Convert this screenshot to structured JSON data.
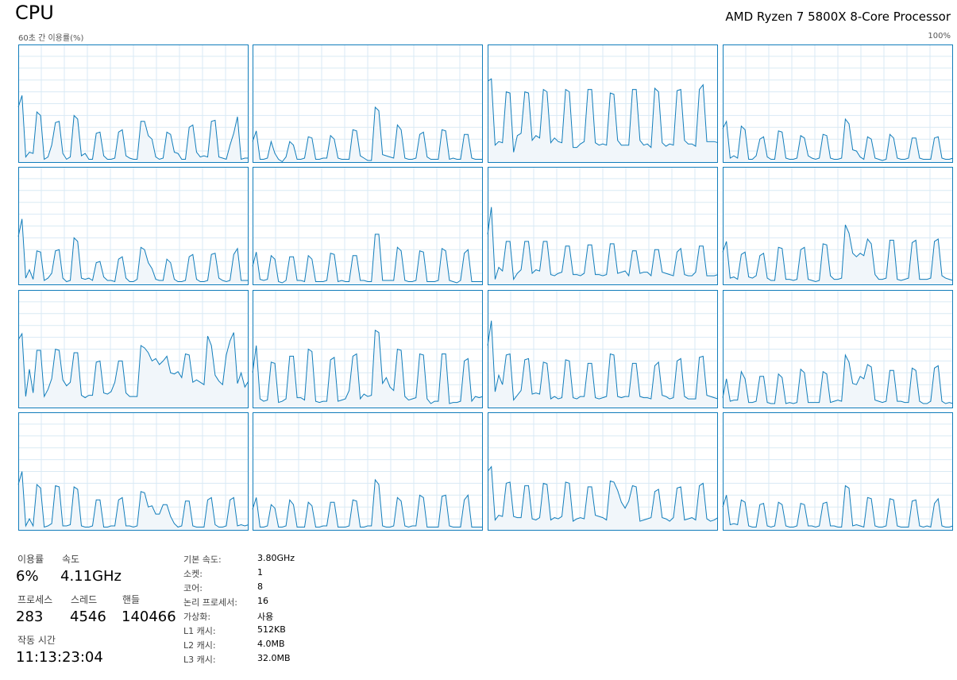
{
  "header": {
    "title": "CPU",
    "processor_name": "AMD Ryzen 7 5800X 8-Core Processor",
    "graph_caption": "60초 간 이용률(%)",
    "graph_max_label": "100%"
  },
  "colors": {
    "graph_border": "#117dbb",
    "graph_line": "#117dbb",
    "graph_fill": "#f1f6fa",
    "grid_line": "#d9eaf4"
  },
  "logical_processor_utilization": {
    "count": 16,
    "range": [
      0,
      100
    ],
    "series": [
      [
        47,
        57,
        5,
        9,
        8,
        43,
        40,
        3,
        5,
        15,
        34,
        35,
        8,
        3,
        5,
        40,
        37,
        6,
        8,
        3,
        3,
        25,
        26,
        6,
        3,
        3,
        4,
        26,
        28,
        6,
        4,
        3,
        3,
        35,
        35,
        23,
        20,
        5,
        3,
        4,
        26,
        24,
        9,
        8,
        3,
        3,
        30,
        32,
        9,
        5,
        6,
        5,
        35,
        36,
        5,
        4,
        3,
        15,
        25,
        39,
        3,
        4,
        4
      ],
      [
        18,
        27,
        3,
        3,
        4,
        18,
        8,
        3,
        1,
        5,
        18,
        15,
        3,
        3,
        4,
        22,
        21,
        3,
        3,
        4,
        4,
        23,
        20,
        4,
        3,
        3,
        3,
        28,
        27,
        6,
        4,
        2,
        2,
        47,
        44,
        7,
        6,
        5,
        4,
        32,
        28,
        4,
        3,
        3,
        4,
        24,
        26,
        5,
        3,
        3,
        3,
        28,
        27,
        3,
        4,
        3,
        3,
        24,
        24,
        4,
        3,
        3,
        3
      ],
      [
        69,
        71,
        15,
        18,
        17,
        60,
        59,
        9,
        23,
        25,
        60,
        59,
        19,
        23,
        21,
        62,
        60,
        17,
        21,
        18,
        17,
        62,
        60,
        13,
        13,
        16,
        18,
        62,
        62,
        17,
        15,
        16,
        15,
        59,
        58,
        19,
        15,
        15,
        15,
        62,
        62,
        19,
        15,
        16,
        13,
        63,
        60,
        17,
        14,
        16,
        15,
        61,
        62,
        19,
        16,
        16,
        14,
        62,
        66,
        18,
        18,
        18,
        17
      ],
      [
        29,
        35,
        4,
        6,
        4,
        31,
        28,
        3,
        3,
        6,
        20,
        22,
        5,
        3,
        3,
        27,
        26,
        4,
        3,
        3,
        4,
        23,
        21,
        6,
        4,
        3,
        4,
        24,
        23,
        4,
        3,
        3,
        4,
        37,
        33,
        11,
        10,
        5,
        3,
        22,
        20,
        4,
        3,
        2,
        3,
        24,
        21,
        4,
        3,
        3,
        4,
        21,
        21,
        4,
        3,
        3,
        3,
        21,
        22,
        4,
        3,
        3,
        4
      ],
      [
        41,
        56,
        6,
        13,
        5,
        29,
        28,
        4,
        6,
        10,
        29,
        30,
        6,
        3,
        4,
        40,
        37,
        6,
        5,
        6,
        4,
        19,
        20,
        7,
        4,
        4,
        3,
        22,
        24,
        6,
        3,
        3,
        5,
        32,
        30,
        19,
        14,
        5,
        4,
        4,
        22,
        19,
        5,
        3,
        3,
        4,
        24,
        26,
        5,
        3,
        3,
        4,
        26,
        27,
        6,
        4,
        3,
        4,
        26,
        31,
        4,
        4,
        4
      ],
      [
        16,
        28,
        5,
        4,
        5,
        25,
        22,
        3,
        2,
        4,
        24,
        24,
        4,
        4,
        3,
        25,
        22,
        3,
        3,
        3,
        4,
        27,
        26,
        3,
        4,
        3,
        3,
        25,
        25,
        4,
        4,
        3,
        3,
        43,
        43,
        4,
        4,
        4,
        4,
        32,
        29,
        4,
        3,
        3,
        4,
        29,
        28,
        3,
        3,
        3,
        4,
        31,
        29,
        4,
        3,
        2,
        4,
        27,
        30,
        3,
        3,
        3,
        3
      ],
      [
        43,
        66,
        5,
        15,
        12,
        37,
        37,
        5,
        10,
        13,
        37,
        37,
        10,
        13,
        12,
        37,
        37,
        9,
        8,
        10,
        11,
        33,
        33,
        9,
        9,
        8,
        10,
        34,
        34,
        9,
        9,
        8,
        9,
        35,
        35,
        10,
        11,
        12,
        8,
        29,
        29,
        10,
        11,
        11,
        8,
        30,
        30,
        11,
        10,
        9,
        8,
        28,
        31,
        9,
        8,
        8,
        11,
        33,
        33,
        8,
        8,
        8,
        9
      ],
      [
        28,
        37,
        6,
        7,
        5,
        26,
        28,
        7,
        6,
        8,
        25,
        27,
        6,
        4,
        4,
        32,
        31,
        5,
        5,
        4,
        5,
        30,
        32,
        5,
        4,
        3,
        4,
        35,
        34,
        8,
        5,
        5,
        6,
        51,
        44,
        27,
        24,
        27,
        25,
        39,
        35,
        9,
        5,
        5,
        6,
        38,
        38,
        5,
        4,
        5,
        6,
        36,
        38,
        5,
        5,
        5,
        6,
        37,
        39,
        8,
        6,
        5,
        4
      ],
      [
        58,
        63,
        10,
        33,
        13,
        49,
        49,
        10,
        16,
        25,
        50,
        49,
        24,
        19,
        22,
        47,
        47,
        11,
        9,
        11,
        11,
        39,
        40,
        13,
        12,
        14,
        22,
        40,
        40,
        13,
        10,
        10,
        10,
        53,
        51,
        47,
        40,
        42,
        37,
        40,
        44,
        30,
        29,
        31,
        26,
        46,
        45,
        22,
        24,
        22,
        20,
        61,
        53,
        28,
        23,
        20,
        45,
        57,
        64,
        21,
        30,
        18,
        23
      ],
      [
        30,
        53,
        8,
        6,
        7,
        39,
        38,
        5,
        6,
        8,
        44,
        44,
        9,
        9,
        7,
        50,
        48,
        6,
        5,
        6,
        6,
        41,
        43,
        6,
        7,
        8,
        15,
        44,
        46,
        8,
        12,
        10,
        11,
        66,
        64,
        21,
        26,
        18,
        15,
        50,
        49,
        10,
        7,
        8,
        9,
        46,
        45,
        8,
        4,
        6,
        6,
        46,
        46,
        4,
        5,
        5,
        6,
        40,
        42,
        6,
        10,
        9,
        10
      ],
      [
        53,
        74,
        14,
        28,
        20,
        45,
        46,
        7,
        11,
        15,
        41,
        42,
        12,
        13,
        12,
        39,
        38,
        8,
        10,
        8,
        9,
        41,
        40,
        9,
        8,
        10,
        10,
        38,
        38,
        9,
        8,
        9,
        10,
        46,
        45,
        10,
        9,
        10,
        10,
        38,
        38,
        10,
        9,
        9,
        8,
        36,
        39,
        11,
        10,
        8,
        9,
        40,
        42,
        10,
        8,
        8,
        8,
        43,
        44,
        11,
        10,
        9,
        8
      ],
      [
        9,
        25,
        6,
        7,
        7,
        31,
        25,
        5,
        5,
        6,
        27,
        27,
        5,
        4,
        4,
        29,
        26,
        4,
        5,
        4,
        5,
        33,
        30,
        5,
        5,
        5,
        5,
        31,
        29,
        5,
        6,
        7,
        6,
        45,
        39,
        21,
        20,
        27,
        25,
        37,
        35,
        7,
        6,
        5,
        6,
        32,
        32,
        6,
        6,
        5,
        5,
        34,
        32,
        6,
        4,
        4,
        6,
        34,
        36,
        6,
        4,
        5,
        4
      ],
      [
        39,
        50,
        4,
        10,
        4,
        39,
        36,
        3,
        4,
        6,
        38,
        37,
        4,
        4,
        5,
        37,
        35,
        4,
        3,
        3,
        4,
        26,
        26,
        3,
        3,
        4,
        4,
        26,
        28,
        4,
        4,
        3,
        4,
        33,
        32,
        20,
        21,
        14,
        14,
        22,
        22,
        12,
        6,
        3,
        4,
        25,
        25,
        4,
        3,
        3,
        3,
        26,
        28,
        5,
        3,
        3,
        4,
        26,
        28,
        4,
        5,
        4,
        5
      ],
      [
        18,
        28,
        3,
        3,
        4,
        22,
        19,
        3,
        3,
        4,
        26,
        22,
        3,
        3,
        3,
        24,
        21,
        3,
        3,
        4,
        4,
        24,
        24,
        3,
        3,
        3,
        4,
        26,
        25,
        3,
        3,
        4,
        4,
        43,
        39,
        4,
        3,
        3,
        4,
        28,
        25,
        4,
        3,
        4,
        4,
        30,
        28,
        3,
        3,
        3,
        3,
        29,
        30,
        4,
        3,
        3,
        3,
        26,
        30,
        3,
        3,
        3,
        3
      ],
      [
        50,
        54,
        9,
        13,
        12,
        40,
        41,
        12,
        11,
        11,
        38,
        38,
        10,
        9,
        11,
        40,
        39,
        9,
        11,
        10,
        12,
        41,
        40,
        8,
        10,
        11,
        10,
        37,
        37,
        13,
        12,
        11,
        9,
        42,
        41,
        34,
        24,
        19,
        25,
        38,
        37,
        8,
        9,
        10,
        11,
        33,
        35,
        11,
        10,
        8,
        11,
        36,
        37,
        9,
        10,
        11,
        9,
        38,
        40,
        10,
        8,
        9,
        11
      ],
      [
        20,
        30,
        5,
        6,
        5,
        26,
        24,
        4,
        3,
        3,
        22,
        23,
        4,
        3,
        4,
        24,
        22,
        4,
        3,
        3,
        4,
        23,
        22,
        4,
        4,
        3,
        4,
        23,
        24,
        4,
        4,
        3,
        3,
        38,
        36,
        4,
        5,
        4,
        3,
        28,
        27,
        4,
        3,
        3,
        4,
        27,
        26,
        4,
        3,
        3,
        3,
        25,
        26,
        4,
        3,
        4,
        3,
        23,
        27,
        4,
        3,
        3,
        4
      ]
    ]
  },
  "stats": {
    "utilization_label": "이용률",
    "utilization_value": "6%",
    "speed_label": "속도",
    "speed_value": "4.11GHz",
    "processes_label": "프로세스",
    "processes_value": "283",
    "threads_label": "스레드",
    "threads_value": "4546",
    "handles_label": "핸들",
    "handles_value": "140466",
    "uptime_label": "작동 시간",
    "uptime_value": "11:13:23:04"
  },
  "info": [
    {
      "label": "기본 속도:",
      "value": "3.80GHz"
    },
    {
      "label": "소켓:",
      "value": "1"
    },
    {
      "label": "코어:",
      "value": "8"
    },
    {
      "label": "논리 프로세서:",
      "value": "16"
    },
    {
      "label": "가상화:",
      "value": "사용"
    },
    {
      "label": "L1 캐시:",
      "value": "512KB"
    },
    {
      "label": "L2 캐시:",
      "value": "4.0MB"
    },
    {
      "label": "L3 캐시:",
      "value": "32.0MB"
    }
  ]
}
